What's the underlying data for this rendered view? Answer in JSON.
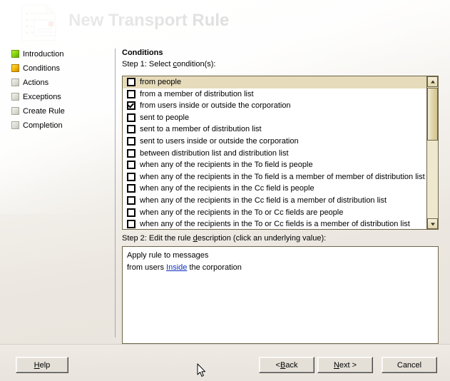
{
  "window": {
    "title": "New Transport Rule",
    "icon": "transport-rule-document-icon"
  },
  "sidebar": {
    "items": [
      {
        "label": "Introduction",
        "state": "green"
      },
      {
        "label": "Conditions",
        "state": "orange"
      },
      {
        "label": "Actions",
        "state": "gray"
      },
      {
        "label": "Exceptions",
        "state": "gray"
      },
      {
        "label": "Create Rule",
        "state": "gray"
      },
      {
        "label": "Completion",
        "state": "gray"
      }
    ]
  },
  "content": {
    "heading": "Conditions",
    "step1_label_pre": "Step 1: Select ",
    "step1_label_accel": "c",
    "step1_label_post": "ondition(s):",
    "step2_label_pre": "Step 2: Edit the rule ",
    "step2_label_accel": "d",
    "step2_label_post": "escription (click an underlying value):",
    "conditions": [
      {
        "label": "from people",
        "checked": false,
        "selected": true
      },
      {
        "label": "from a member of distribution list",
        "checked": false,
        "selected": false
      },
      {
        "label": "from users inside or outside the corporation",
        "checked": true,
        "selected": false
      },
      {
        "label": "sent to people",
        "checked": false,
        "selected": false
      },
      {
        "label": "sent to a member of distribution list",
        "checked": false,
        "selected": false
      },
      {
        "label": "sent to users inside or outside the corporation",
        "checked": false,
        "selected": false
      },
      {
        "label": "between distribution list and distribution list",
        "checked": false,
        "selected": false
      },
      {
        "label": "when any of the recipients in the To field is people",
        "checked": false,
        "selected": false
      },
      {
        "label": "when any of the recipients in the To field is a member of member of distribution list",
        "checked": false,
        "selected": false
      },
      {
        "label": "when any of the recipients in the Cc field is people",
        "checked": false,
        "selected": false
      },
      {
        "label": "when any of the recipients in the Cc field is a member of distribution list",
        "checked": false,
        "selected": false
      },
      {
        "label": "when any of the recipients in the To or Cc fields are people",
        "checked": false,
        "selected": false
      },
      {
        "label": "when any of the recipients in the To or Cc fields is a member of distribution list",
        "checked": false,
        "selected": false
      }
    ],
    "description": {
      "line1": "Apply rule to messages",
      "line2_pre": "from users ",
      "line2_link": "Inside",
      "line2_post": " the corporation"
    }
  },
  "footer": {
    "help": {
      "pre": "",
      "accel": "H",
      "post": "elp"
    },
    "back": {
      "pre": "< ",
      "accel": "B",
      "post": "ack"
    },
    "next": {
      "pre": "",
      "accel": "N",
      "post": "ext >"
    },
    "cancel": {
      "pre": "Cancel",
      "accel": "",
      "post": ""
    }
  },
  "colors": {
    "accent_selected_row": "#e6dcbb",
    "link": "#0b2fc4",
    "frame_border": "#6e6548",
    "step_green": "#7fd30d",
    "step_orange": "#f2b400"
  }
}
